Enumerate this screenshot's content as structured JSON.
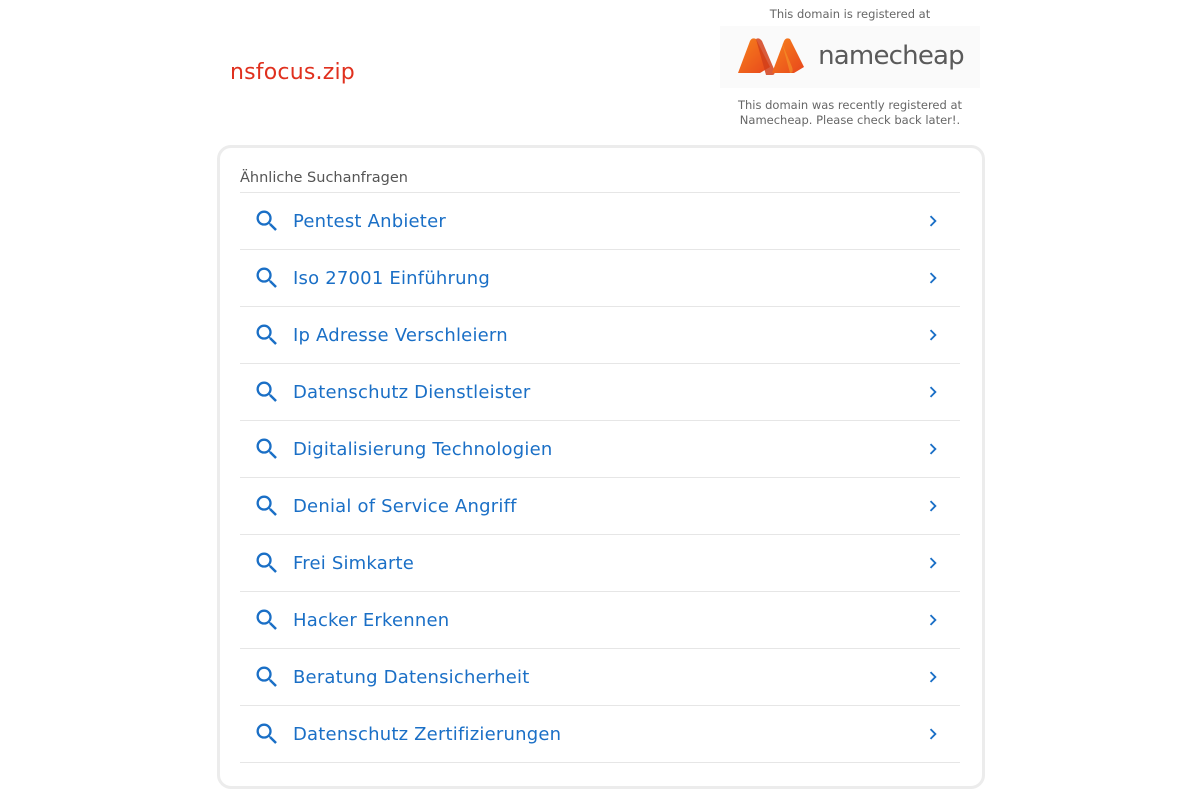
{
  "header": {
    "domain": "nsfocus.zip"
  },
  "registrar": {
    "top_text": "This domain is registered at",
    "logo_word": "namecheap",
    "bottom_line1": "This domain was recently registered at",
    "bottom_line2": "Namecheap. Please check back later!.",
    "brand_orange": "#f05a22"
  },
  "related": {
    "heading": "Ähnliche Suchanfragen",
    "items": [
      {
        "label": "Pentest Anbieter",
        "icon": "search-icon",
        "action_icon": "chevron-right-icon"
      },
      {
        "label": "Iso 27001 Einführung",
        "icon": "search-icon",
        "action_icon": "chevron-right-icon"
      },
      {
        "label": "Ip Adresse Verschleiern",
        "icon": "search-icon",
        "action_icon": "chevron-right-icon"
      },
      {
        "label": "Datenschutz Dienstleister",
        "icon": "search-icon",
        "action_icon": "chevron-right-icon"
      },
      {
        "label": "Digitalisierung Technologien",
        "icon": "search-icon",
        "action_icon": "chevron-right-icon"
      },
      {
        "label": "Denial of Service Angriff",
        "icon": "search-icon",
        "action_icon": "chevron-right-icon"
      },
      {
        "label": "Frei Simkarte",
        "icon": "search-icon",
        "action_icon": "chevron-right-icon"
      },
      {
        "label": "Hacker Erkennen",
        "icon": "search-icon",
        "action_icon": "chevron-right-icon"
      },
      {
        "label": "Beratung Datensicherheit",
        "icon": "search-icon",
        "action_icon": "chevron-right-icon"
      },
      {
        "label": "Datenschutz Zertifizierungen",
        "icon": "search-icon",
        "action_icon": "chevron-right-icon"
      }
    ]
  },
  "colors": {
    "domain_red": "#e0301e",
    "link_blue": "#1a6fc6"
  }
}
